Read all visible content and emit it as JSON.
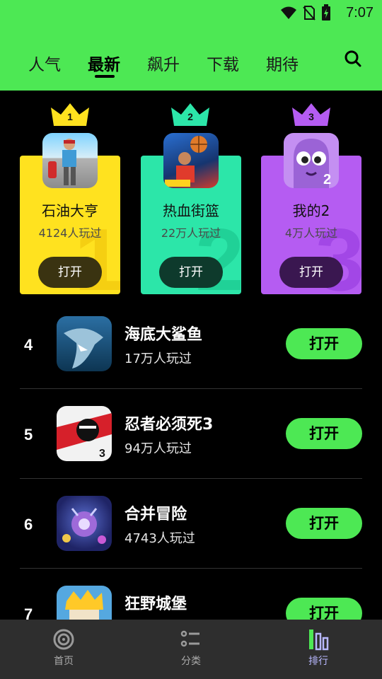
{
  "status_bar": {
    "time": "7:07"
  },
  "tabs": [
    {
      "label": "人气",
      "active": false
    },
    {
      "label": "最新",
      "active": true
    },
    {
      "label": "飙升",
      "active": false
    },
    {
      "label": "下载",
      "active": false
    },
    {
      "label": "期待",
      "active": false
    }
  ],
  "search": {
    "icon": "search-icon"
  },
  "podium": [
    {
      "rank": "1",
      "name": "石油大亨",
      "plays": "4124人玩过",
      "open_label": "打开",
      "color": "#ffe21f"
    },
    {
      "rank": "2",
      "name": "热血街篮",
      "plays": "22万人玩过",
      "open_label": "打开",
      "color": "#2ce6a9"
    },
    {
      "rank": "3",
      "name": "我的2",
      "plays": "4万人玩过",
      "open_label": "打开",
      "color": "#b55cf2"
    }
  ],
  "list": [
    {
      "rank": "4",
      "name": "海底大鲨鱼",
      "plays": "17万人玩过",
      "open_label": "打开"
    },
    {
      "rank": "5",
      "name": "忍者必须死3",
      "plays": "94万人玩过",
      "open_label": "打开"
    },
    {
      "rank": "6",
      "name": "合并冒险",
      "plays": "4743人玩过",
      "open_label": "打开"
    },
    {
      "rank": "7",
      "name": "狂野城堡",
      "plays": "",
      "open_label": "打开"
    }
  ],
  "bottom_nav": [
    {
      "label": "首页",
      "icon": "home-swirl-icon",
      "active": false
    },
    {
      "label": "分类",
      "icon": "category-list-icon",
      "active": false
    },
    {
      "label": "排行",
      "icon": "ranking-bars-icon",
      "active": true
    }
  ],
  "colors": {
    "accent": "#4de854",
    "background": "#000000",
    "nav_bg": "#2e2e2e"
  }
}
